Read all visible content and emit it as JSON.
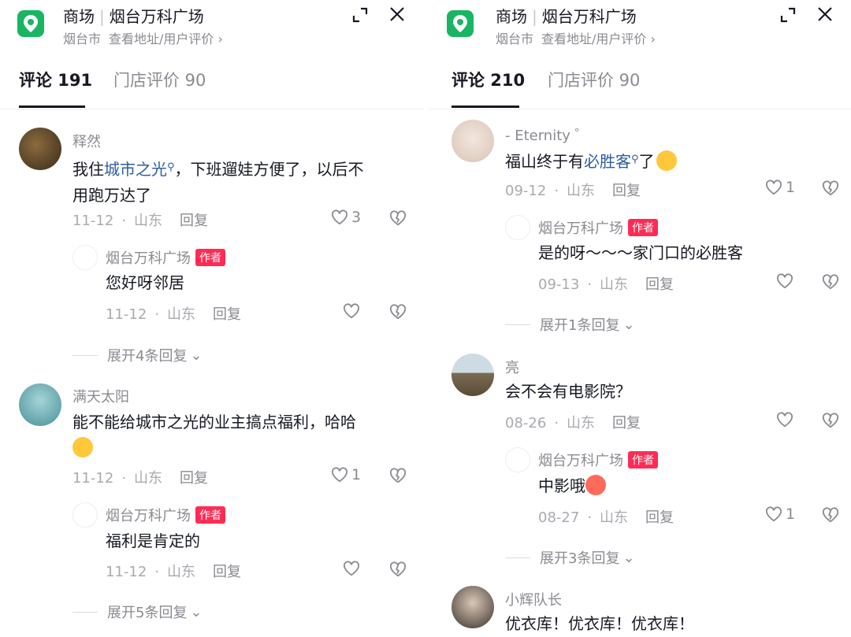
{
  "left": {
    "header": {
      "title_a": "商场",
      "title_b": "烟台万科广场",
      "sub_city": "烟台市",
      "sub_link": "查看地址/用户评价 ›"
    },
    "tabs": [
      {
        "label": "评论 191"
      },
      {
        "label": "门店评价 90"
      }
    ],
    "comments": [
      {
        "user": "释然",
        "text_a": "我住",
        "text_link": "城市之光",
        "text_b": "，下班遛娃方便了，以后不",
        "text_c": "用跑万达了",
        "date": "11-12",
        "region": "山东",
        "reply": "回复",
        "likes": "3",
        "sub": {
          "user": "烟台万科广场",
          "badge": "作者",
          "text": "您好呀邻居",
          "date": "11-12",
          "region": "山东",
          "reply": "回复"
        },
        "expand": "展开4条回复"
      },
      {
        "user": "满天太阳",
        "text_a": "能不能给城市之光的业主搞点福利，哈哈",
        "date": "11-12",
        "region": "山东",
        "reply": "回复",
        "likes": "1",
        "sub": {
          "user": "烟台万科广场",
          "badge": "作者",
          "text": "福利是肯定的",
          "date": "11-12",
          "region": "山东",
          "reply": "回复"
        },
        "expand": "展开5条回复"
      }
    ]
  },
  "right": {
    "header": {
      "title_a": "商场",
      "title_b": "烟台万科广场",
      "sub_city": "烟台市",
      "sub_link": "查看地址/用户评价 ›"
    },
    "tabs": [
      {
        "label": "评论 210"
      },
      {
        "label": "门店评价 90"
      }
    ],
    "comments": [
      {
        "user": "- Eternity ゜",
        "text_a": "福山终于有",
        "text_link": "必胜客",
        "text_b": "了",
        "date": "09-12",
        "region": "山东",
        "reply": "回复",
        "likes": "1",
        "sub": {
          "user": "烟台万科广场",
          "badge": "作者",
          "text": "是的呀～～～家门口的必胜客",
          "date": "09-13",
          "region": "山东",
          "reply": "回复"
        },
        "expand": "展开1条回复"
      },
      {
        "user": "亮",
        "text_a": "会不会有电影院？",
        "date": "08-26",
        "region": "山东",
        "reply": "回复",
        "sub": {
          "user": "烟台万科广场",
          "badge": "作者",
          "text": "中影哦",
          "date": "08-27",
          "region": "山东",
          "reply": "回复",
          "likes": "1"
        },
        "expand": "展开3条回复"
      },
      {
        "user": "小辉队长",
        "text_a": "优衣库！优衣库！优衣库！"
      }
    ]
  },
  "colors": {
    "accent_green": "#19b563",
    "author_red": "#fe2c55",
    "link_blue": "#2c5d9f"
  }
}
